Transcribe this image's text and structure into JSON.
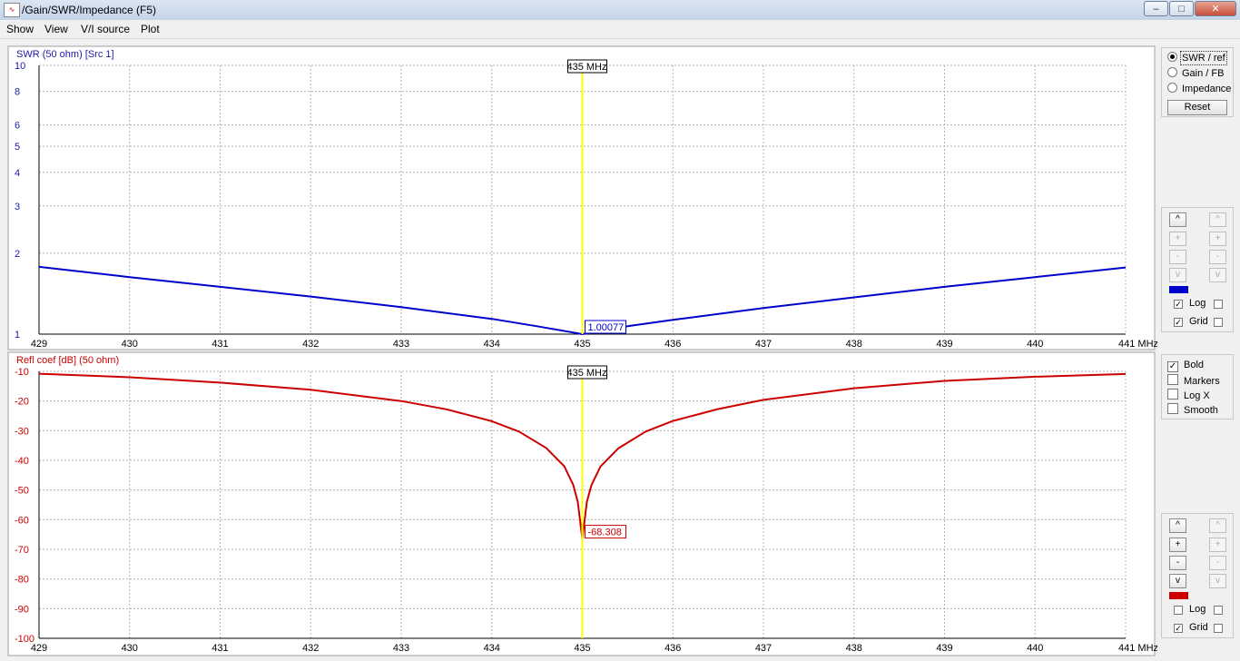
{
  "window": {
    "title": "/Gain/SWR/Impedance (F5)",
    "icon": "chart-app-icon",
    "buttons": {
      "minimize": "–",
      "maximize": "□",
      "close": "✕"
    }
  },
  "menu": [
    "Show",
    "View",
    "V/I source",
    "Plot"
  ],
  "colors": {
    "swr": "#0000cc",
    "refl": "#cc0000",
    "marker": "#ffff00",
    "grid": "#b4b4b4",
    "axis_text_swr": "#1a1aa8",
    "axis_text_refl": "#cc0000"
  },
  "chart_data": [
    {
      "type": "line",
      "title": "SWR (50 ohm) [Src 1]",
      "y_scale": "log",
      "ylim": [
        1,
        10
      ],
      "yticks": [
        "10",
        "8",
        "6",
        "5",
        "4",
        "3",
        "2",
        "1"
      ],
      "xlim": [
        429,
        441
      ],
      "xticks": [
        "429",
        "430",
        "431",
        "432",
        "433",
        "434",
        "435",
        "436",
        "437",
        "438",
        "439",
        "440",
        "441 MHz"
      ],
      "grid": true,
      "marker": {
        "x": 435,
        "label": "435 MHz"
      },
      "readout": "1.00077",
      "series": [
        {
          "x": [
            429,
            430,
            431,
            432,
            433,
            434,
            434.5,
            435,
            435.5,
            436,
            437,
            438,
            439,
            440,
            441
          ],
          "y": [
            1.78,
            1.63,
            1.5,
            1.38,
            1.26,
            1.14,
            1.07,
            1.0,
            1.07,
            1.13,
            1.25,
            1.37,
            1.5,
            1.63,
            1.77
          ]
        }
      ]
    },
    {
      "type": "line",
      "title": "Refl coef [dB] (50 ohm)",
      "ylim": [
        -100,
        -10
      ],
      "yticks": [
        "-10",
        "-20",
        "-30",
        "-40",
        "-50",
        "-60",
        "-70",
        "-80",
        "-90",
        "-100"
      ],
      "xlim": [
        429,
        441
      ],
      "xticks": [
        "429",
        "430",
        "431",
        "432",
        "433",
        "434",
        "435",
        "436",
        "437",
        "438",
        "439",
        "440",
        "441 MHz"
      ],
      "grid": true,
      "marker": {
        "x": 435,
        "label": "435 MHz"
      },
      "readout": "-68.308",
      "series": [
        {
          "x": [
            429,
            430,
            431,
            432,
            433,
            433.5,
            434,
            434.3,
            434.6,
            434.8,
            434.9,
            434.95,
            435,
            435.05,
            435.1,
            435.2,
            435.4,
            435.7,
            436,
            436.5,
            437,
            438,
            439,
            440,
            441
          ],
          "y": [
            -10.8,
            -12.0,
            -13.8,
            -16.2,
            -20.0,
            -22.8,
            -26.8,
            -30.3,
            -35.8,
            -42.0,
            -48.3,
            -54.0,
            -66.5,
            -54.0,
            -48.4,
            -42.1,
            -35.9,
            -30.3,
            -26.7,
            -22.7,
            -19.6,
            -15.7,
            -13.2,
            -11.8,
            -10.9
          ]
        }
      ]
    }
  ],
  "plot_panel": {
    "radios": [
      {
        "label": "SWR / ref",
        "checked": true
      },
      {
        "label": "Gain / FB",
        "checked": false
      },
      {
        "label": "Impedance",
        "checked": false
      }
    ],
    "reset": "Reset"
  },
  "swr_controls": {
    "buttons": [
      "^",
      "+",
      "-",
      "v"
    ],
    "log_label": "Log",
    "grid_label": "Grid",
    "log_checked": true,
    "grid_checked": true
  },
  "options_panel": {
    "items": [
      {
        "label": "Bold",
        "checked": true
      },
      {
        "label": "Markers",
        "checked": false
      },
      {
        "label": "Log X",
        "checked": false
      },
      {
        "label": "Smooth",
        "checked": false
      }
    ]
  },
  "refl_controls": {
    "buttons": [
      "^",
      "+",
      "-",
      "v"
    ],
    "log_label": "Log",
    "grid_label": "Grid",
    "log_checked": false,
    "grid_checked": true
  }
}
